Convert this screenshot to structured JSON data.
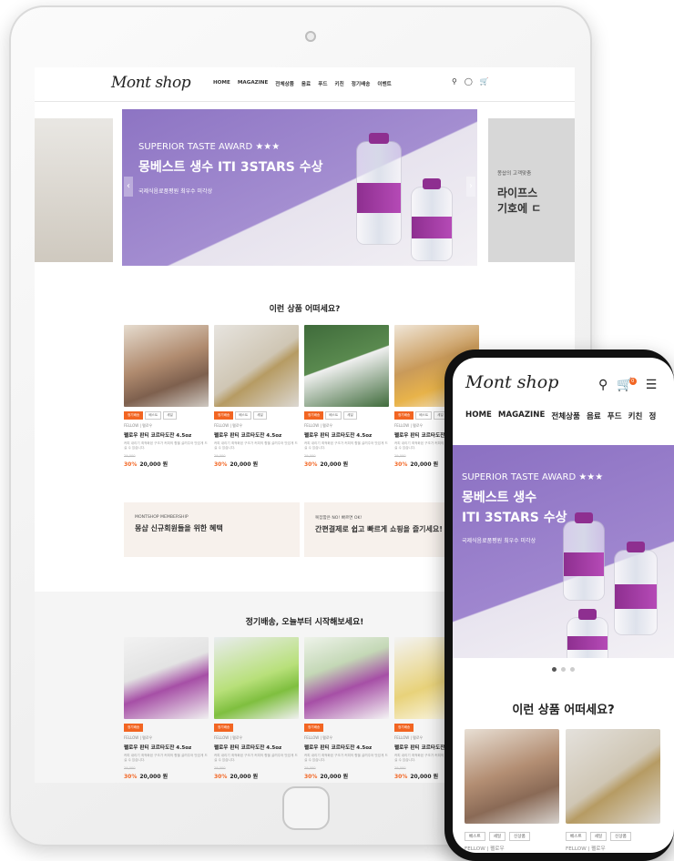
{
  "tablet": {
    "logo": "Mont shop",
    "menu": [
      "HOME",
      "MAGAZINE",
      "전체상품",
      "음료",
      "푸드",
      "키친",
      "정기배송",
      "이벤트"
    ],
    "icons": [
      "search-icon",
      "user-icon",
      "cart-icon"
    ],
    "hero": {
      "award": "SUPERIOR TASTE AWARD ★★★",
      "headline": "몽베스트 생수 ITI 3STARS 수상",
      "sub": "국제식음료품평원 최우수 미각상"
    },
    "side_slide": {
      "small": "몽샵의 고객맞춤 ",
      "big_line1": "라이프스",
      "big_line2": "기호에 ㄷ"
    },
    "section1_title": "이런 상품 어떠세요?",
    "section2_title": "정기배송, 오늘부터 시작해보세요!",
    "products1": [
      {
        "tags": [
          "정기배송",
          "베스트",
          "세일"
        ],
        "brand": "FELLOW | 펠로우",
        "name": "펠로우 판티 코르타도잔 4.5oz",
        "desc": "커피 내리기 최적화된 구조가 커피의 향을 살려주어 맛있게 드실 수 있습니다.",
        "orig": "29,000",
        "pct": "30%",
        "price": "20,000 원"
      },
      {
        "tags": [
          "정기배송",
          "베스트",
          "세일"
        ],
        "brand": "FELLOW | 펠로우",
        "name": "펠로우 판티 코르타도잔 4.5oz",
        "desc": "커피 내리기 최적화된 구조가 커피의 향을 살려주어 맛있게 드실 수 있습니다.",
        "orig": "29,000",
        "pct": "30%",
        "price": "20,000 원"
      },
      {
        "tags": [
          "정기배송",
          "베스트",
          "세일"
        ],
        "brand": "FELLOW | 펠로우",
        "name": "펠로우 판티 코르타도잔 4.5oz",
        "desc": "커피 내리기 최적화된 구조가 커피의 향을 살려주어 맛있게 드실 수 있습니다.",
        "orig": "29,000",
        "pct": "30%",
        "price": "20,000 원"
      },
      {
        "tags": [
          "정기배송",
          "베스트",
          "세일"
        ],
        "brand": "FELLOW | 펠로우",
        "name": "펠로우 판티 코르타도잔",
        "desc": "커피 내리기 최적화된 구조가 커피의 향을 살려주어 맛있게 드실 수 있습니다.",
        "orig": "29,000",
        "pct": "30%",
        "price": "20,000 원"
      }
    ],
    "banners": [
      {
        "small": "MONTSHOP MEMBERSHIP",
        "big": "몽샵 신규회원들을 위한 혜택"
      },
      {
        "small": "복잡함은 NO! 빠르면 OK!",
        "big": "간편결제로 쉽고 빠르게 쇼핑을 즐기세요!"
      }
    ],
    "products2": [
      {
        "tags": [
          "정기배송"
        ],
        "brand": "FELLOW | 펠로우",
        "name": "펠로우 판티 코르타도잔 4.5oz",
        "desc": "커피 내리기 최적화된 구조가 커피의 향을 살려주어 맛있게 드실 수 있습니다.",
        "orig": "29,000",
        "pct": "30%",
        "price": "20,000 원"
      },
      {
        "tags": [
          "정기배송"
        ],
        "brand": "FELLOW | 펠로우",
        "name": "펠로우 판티 코르타도잔 4.5oz",
        "desc": "커피 내리기 최적화된 구조가 커피의 향을 살려주어 맛있게 드실 수 있습니다.",
        "orig": "29,000",
        "pct": "30%",
        "price": "20,000 원"
      },
      {
        "tags": [
          "정기배송"
        ],
        "brand": "FELLOW | 펠로우",
        "name": "펠로우 판티 코르타도잔 4.5oz",
        "desc": "커피 내리기 최적화된 구조가 커피의 향을 살려주어 맛있게 드실 수 있습니다.",
        "orig": "29,000",
        "pct": "30%",
        "price": "20,000 원"
      },
      {
        "tags": [
          "정기배송"
        ],
        "brand": "FELLOW | 펠로우",
        "name": "펠로우 판티 코르타도잔",
        "desc": "커피 내리기 최적화된 구조가 커피의 향을 살려주어 맛있게 드실 수 있습니다.",
        "orig": "29,000",
        "pct": "30%",
        "price": "20,000 원"
      }
    ]
  },
  "phone": {
    "logo": "Mont shop",
    "cart_count": "0",
    "menu": [
      "HOME",
      "MAGAZINE",
      "전체상품",
      "음료",
      "푸드",
      "키친",
      "정"
    ],
    "hero": {
      "award": "SUPERIOR TASTE AWARD ★★★",
      "line1": "몽베스트 생수",
      "line2": "ITI 3STARS 수상",
      "sub": "국제식음료품평원 최우수 미각상"
    },
    "section_title": "이런 상품 어떠세요?",
    "cards": [
      {
        "tags": [
          "베스트",
          "세일",
          "신상품"
        ],
        "brand": "FELLOW | 펠로우"
      },
      {
        "tags": [
          "베스트",
          "세일",
          "신상품"
        ],
        "brand": "FELLOW | 펠로우"
      }
    ]
  },
  "colors": {
    "accent": "#f26522",
    "hero_purple": "#9a7fc9",
    "cap_purple": "#8e2f90",
    "banner_bg": "#f7f1ec"
  }
}
